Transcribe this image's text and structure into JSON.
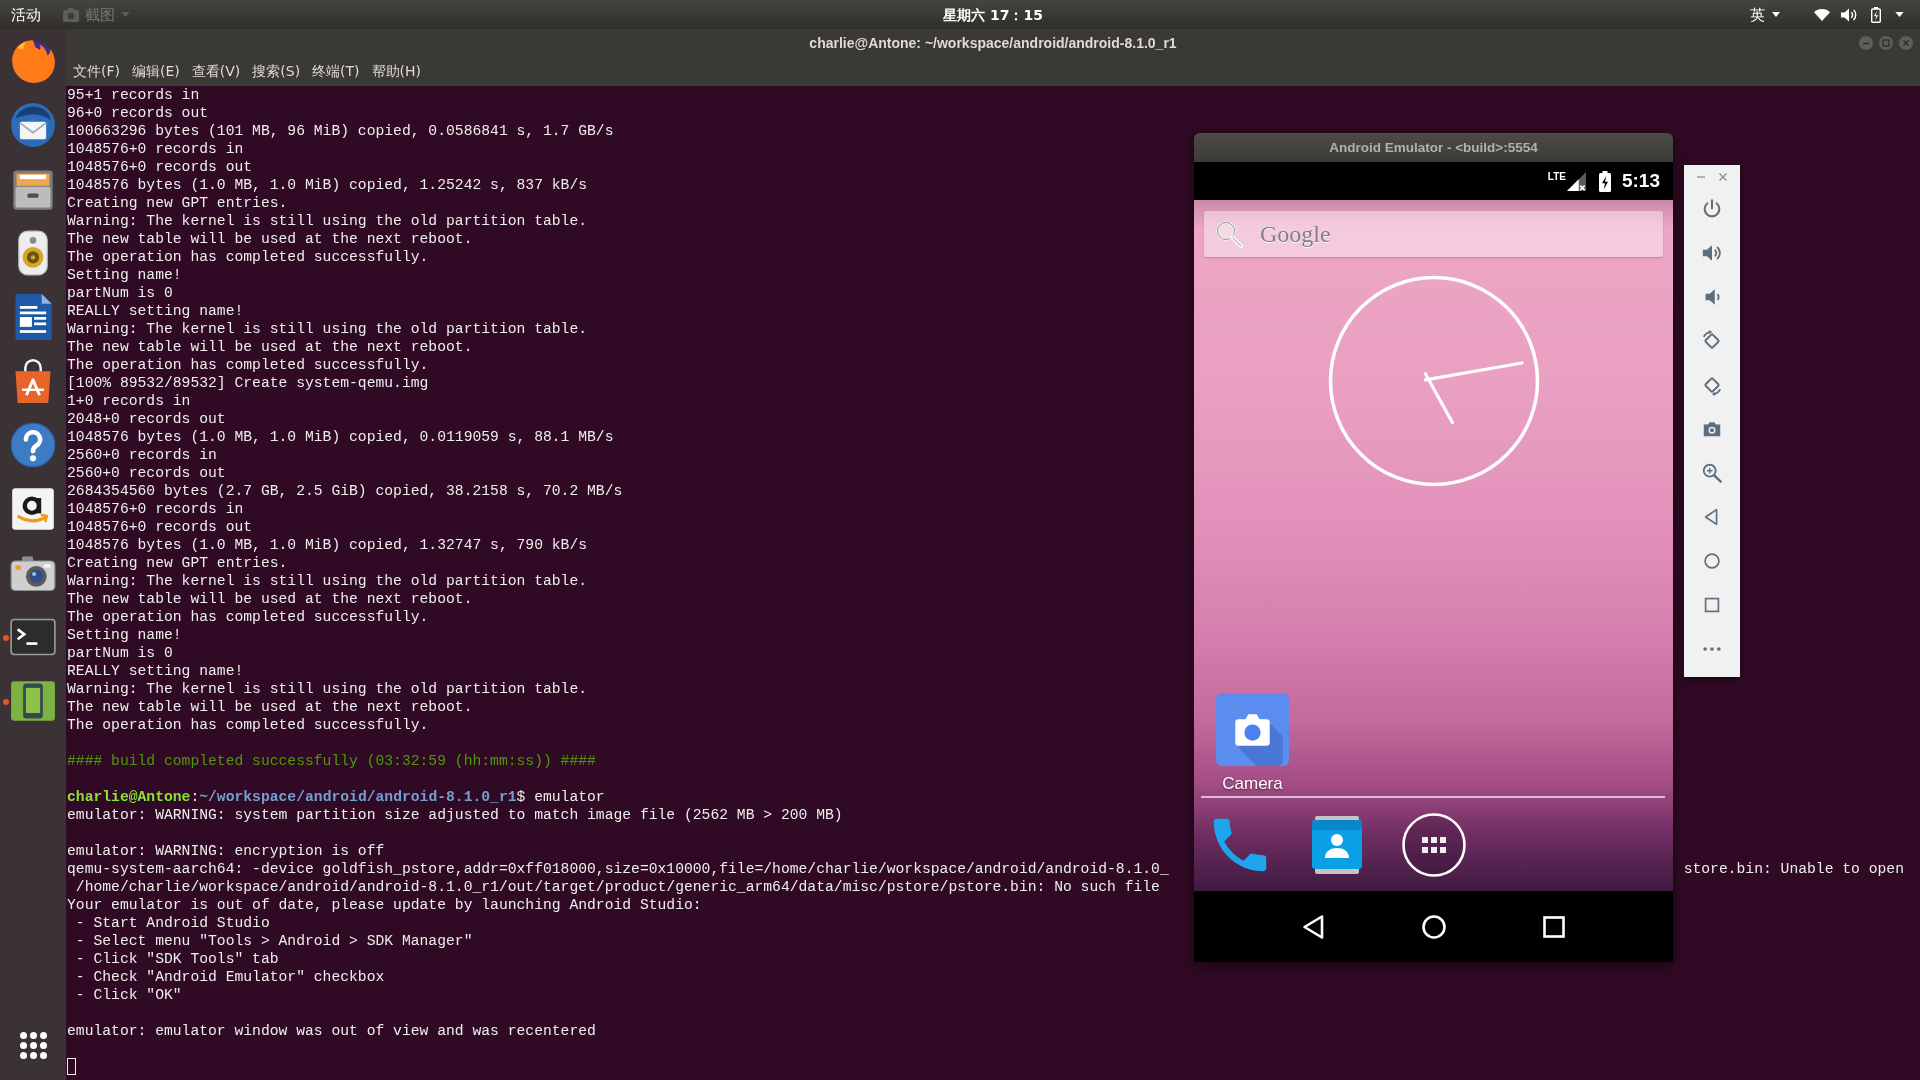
{
  "top_bar": {
    "activities": "活动",
    "app_menu": "截图",
    "clock": "星期六 17：15",
    "input_method": "英"
  },
  "dock": {
    "items": [
      {
        "kind": "browser",
        "running": false
      },
      {
        "kind": "mail",
        "running": false
      },
      {
        "kind": "files",
        "running": false
      },
      {
        "kind": "music",
        "running": false
      },
      {
        "kind": "writer",
        "running": false
      },
      {
        "kind": "store",
        "running": false
      },
      {
        "kind": "help",
        "running": false
      },
      {
        "kind": "amazon",
        "running": false
      },
      {
        "kind": "photo",
        "running": false
      },
      {
        "kind": "terminal",
        "running": true
      },
      {
        "kind": "emulator",
        "running": true
      }
    ]
  },
  "terminal": {
    "title": "charlie@Antone: ~/workspace/android/android-8.1.0_r1",
    "window_buttons": [
      {
        "kind": "minimize"
      },
      {
        "kind": "maximize"
      },
      {
        "kind": "close"
      }
    ],
    "menu": [
      "文件(F)",
      "编辑(E)",
      "查看(V)",
      "搜索(S)",
      "终端(T)",
      "帮助(H)"
    ],
    "lines": [
      {
        "kind": "output",
        "text": "95+1 records in"
      },
      {
        "kind": "output",
        "text": "96+0 records out"
      },
      {
        "kind": "output",
        "text": "100663296 bytes (101 MB, 96 MiB) copied, 0.0586841 s, 1.7 GB/s"
      },
      {
        "kind": "output",
        "text": "1048576+0 records in"
      },
      {
        "kind": "output",
        "text": "1048576+0 records out"
      },
      {
        "kind": "output",
        "text": "1048576 bytes (1.0 MB, 1.0 MiB) copied, 1.25242 s, 837 kB/s"
      },
      {
        "kind": "output",
        "text": "Creating new GPT entries."
      },
      {
        "kind": "output",
        "text": "Warning: The kernel is still using the old partition table."
      },
      {
        "kind": "output",
        "text": "The new table will be used at the next reboot."
      },
      {
        "kind": "output",
        "text": "The operation has completed successfully."
      },
      {
        "kind": "output",
        "text": "Setting name!"
      },
      {
        "kind": "output",
        "text": "partNum is 0"
      },
      {
        "kind": "output",
        "text": "REALLY setting name!"
      },
      {
        "kind": "output",
        "text": "Warning: The kernel is still using the old partition table."
      },
      {
        "kind": "output",
        "text": "The new table will be used at the next reboot."
      },
      {
        "kind": "output",
        "text": "The operation has completed successfully."
      },
      {
        "kind": "output",
        "text": "[100% 89532/89532] Create system-qemu.img"
      },
      {
        "kind": "output",
        "text": "1+0 records in"
      },
      {
        "kind": "output",
        "text": "2048+0 records out"
      },
      {
        "kind": "output",
        "text": "1048576 bytes (1.0 MB, 1.0 MiB) copied, 0.0119059 s, 88.1 MB/s"
      },
      {
        "kind": "output",
        "text": "2560+0 records in"
      },
      {
        "kind": "output",
        "text": "2560+0 records out"
      },
      {
        "kind": "output",
        "text": "2684354560 bytes (2.7 GB, 2.5 GiB) copied, 38.2158 s, 70.2 MB/s"
      },
      {
        "kind": "output",
        "text": "1048576+0 records in"
      },
      {
        "kind": "output",
        "text": "1048576+0 records out"
      },
      {
        "kind": "output",
        "text": "1048576 bytes (1.0 MB, 1.0 MiB) copied, 1.32747 s, 790 kB/s"
      },
      {
        "kind": "output",
        "text": "Creating new GPT entries."
      },
      {
        "kind": "output",
        "text": "Warning: The kernel is still using the old partition table."
      },
      {
        "kind": "output",
        "text": "The new table will be used at the next reboot."
      },
      {
        "kind": "output",
        "text": "The operation has completed successfully."
      },
      {
        "kind": "output",
        "text": "Setting name!"
      },
      {
        "kind": "output",
        "text": "partNum is 0"
      },
      {
        "kind": "output",
        "text": "REALLY setting name!"
      },
      {
        "kind": "output",
        "text": "Warning: The kernel is still using the old partition table."
      },
      {
        "kind": "output",
        "text": "The new table will be used at the next reboot."
      },
      {
        "kind": "output",
        "text": "The operation has completed successfully."
      },
      {
        "kind": "blank"
      },
      {
        "kind": "success",
        "text": "#### build completed successfully (03:32:59 (hh:mm:ss)) ####"
      },
      {
        "kind": "blank"
      },
      {
        "kind": "prompt",
        "user": "charlie@Antone",
        "separator": ":",
        "path": "~/workspace/android/android-8.1.0_r1",
        "command": "$ emulator"
      },
      {
        "kind": "output",
        "text": "emulator: WARNING: system partition size adjusted to match image file (2562 MB > 200 MB)"
      },
      {
        "kind": "blank"
      },
      {
        "kind": "output",
        "text": "emulator: WARNING: encryption is off"
      },
      {
        "kind": "split",
        "left": "qemu-system-aarch64: -device goldfish_pstore,addr=0xff018000,size=0x10000,file=/home/charlie/workspace/android/android-8.1.0_",
        "right": "store.bin: Unable to open"
      },
      {
        "kind": "output",
        "text": " /home/charlie/workspace/android/android-8.1.0_r1/out/target/product/generic_arm64/data/misc/pstore/pstore.bin: No such file"
      },
      {
        "kind": "output",
        "text": "Your emulator is out of date, please update by launching Android Studio:"
      },
      {
        "kind": "output",
        "text": " - Start Android Studio"
      },
      {
        "kind": "output",
        "text": " - Select menu \"Tools > Android > SDK Manager\""
      },
      {
        "kind": "output",
        "text": " - Click \"SDK Tools\" tab"
      },
      {
        "kind": "output",
        "text": " - Check \"Android Emulator\" checkbox"
      },
      {
        "kind": "output",
        "text": " - Click \"OK\""
      },
      {
        "kind": "blank"
      },
      {
        "kind": "output",
        "text": "emulator: emulator window was out of view and was recentered"
      },
      {
        "kind": "blank"
      },
      {
        "kind": "cursor"
      }
    ]
  },
  "emulator": {
    "title": "Android Emulator - <build>:5554",
    "status_bar": {
      "network": "LTE",
      "time": "5:13"
    },
    "search_bar": {
      "logo": "Google"
    },
    "home_apps": [
      {
        "kind": "camera",
        "label": "Camera"
      }
    ],
    "hotseat": [
      {
        "kind": "phone"
      },
      {
        "kind": "contacts"
      },
      {
        "kind": "apps"
      }
    ],
    "nav_bar": [
      {
        "kind": "back"
      },
      {
        "kind": "home"
      },
      {
        "kind": "recents"
      }
    ]
  },
  "emulator_toolbar": {
    "window_buttons": [
      {
        "kind": "minimize"
      },
      {
        "kind": "close"
      }
    ],
    "tools": [
      {
        "kind": "power"
      },
      {
        "kind": "volume_up"
      },
      {
        "kind": "volume_down"
      },
      {
        "kind": "rotate_left"
      },
      {
        "kind": "rotate_right"
      },
      {
        "kind": "screenshot"
      },
      {
        "kind": "zoom"
      },
      {
        "kind": "back"
      },
      {
        "kind": "home"
      },
      {
        "kind": "overview"
      },
      {
        "kind": "more"
      }
    ]
  }
}
